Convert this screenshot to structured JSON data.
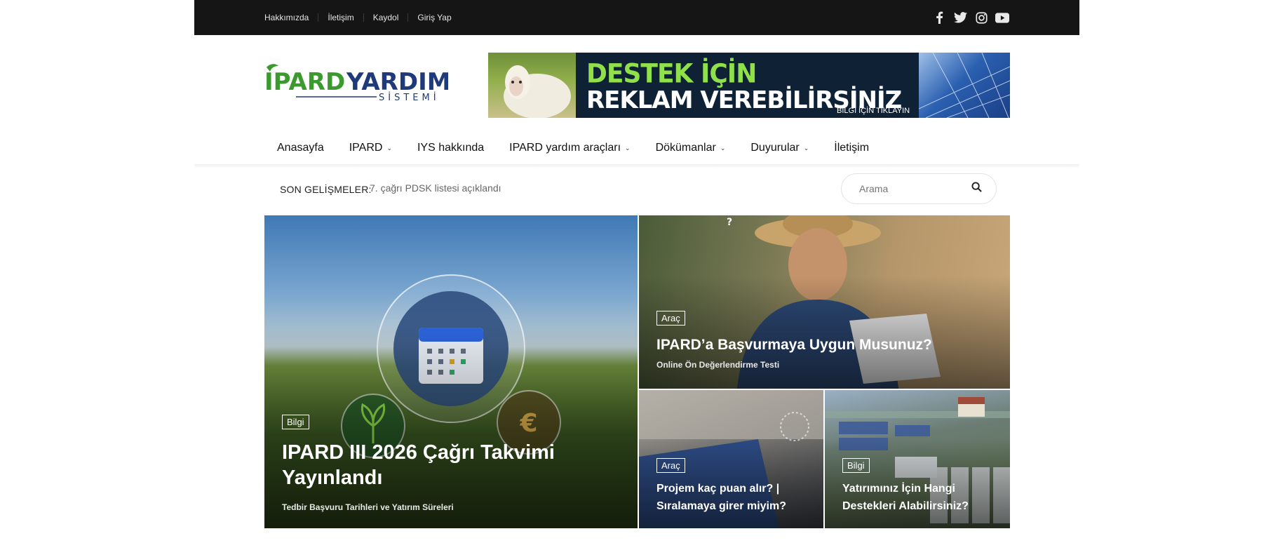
{
  "topbar": {
    "links": [
      "Hakkımızda",
      "İletişim",
      "Kaydol",
      "Giriş Yap"
    ],
    "social_icons": [
      "facebook-icon",
      "twitter-icon",
      "instagram-icon",
      "youtube-icon"
    ]
  },
  "logo": {
    "main_1": "IPARD",
    "main_2": "YARDIM",
    "sub": "SİSTEMİ"
  },
  "banner": {
    "line1": "DESTEK İÇİN",
    "line2": "REKLAM VEREBİLİRSİNİZ",
    "cta": "BİLGİ İÇİN TIKLAYIN"
  },
  "nav": {
    "items": [
      {
        "label": "Anasayfa",
        "dropdown": false
      },
      {
        "label": "IPARD",
        "dropdown": true
      },
      {
        "label": "IYS hakkında",
        "dropdown": false
      },
      {
        "label": "IPARD yardım araçları",
        "dropdown": true
      },
      {
        "label": "Dökümanlar",
        "dropdown": true
      },
      {
        "label": "Duyurular",
        "dropdown": true
      },
      {
        "label": "İletişim",
        "dropdown": false
      }
    ]
  },
  "ticker": {
    "label": "SON GELİŞMELER:",
    "text": "7. çağrı PDSK listesi açıklandı"
  },
  "search": {
    "placeholder": "Arama"
  },
  "posts": [
    {
      "category": "Bilgi",
      "title_line1": "IPARD III 2026 Çağrı Takvimi",
      "title_line2": "Yayınlandı",
      "subtitle": "Tedbir Başvuru Tarihleri ve Yatırım Süreleri"
    },
    {
      "category": "Araç",
      "title": "IPARD’a Başvurmaya Uygun Musunuz?",
      "subtitle": "Online Ön Değerlendirme Testi"
    },
    {
      "category": "Araç",
      "title_line1": "Projem kaç puan alır? |",
      "title_line2": "Sıralamaya girer miyim?"
    },
    {
      "category": "Bilgi",
      "title_line1": "Yatırımınız İçin Hangi",
      "title_line2": "Destekleri Alabilirsiniz?"
    }
  ],
  "colors": {
    "topbar": "#151515",
    "logo_green": "#3a9a2e",
    "logo_blue": "#1f3a7a",
    "banner_bg": "#0f2235",
    "banner_green": "#8fe04a"
  }
}
